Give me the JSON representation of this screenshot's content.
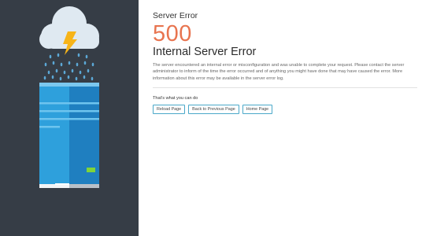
{
  "error": {
    "label": "Server Error",
    "code": "500",
    "title": "Internal Server Error",
    "description": "The server encountered an internal error or misconfiguration and was unable to complete your request. Please contact the server administrator to inform of the time the error occurred and of anything you might have done that may have caused the error. More information about this error may be available in the server error log."
  },
  "actions": {
    "heading": "That's what you can do",
    "buttons": [
      {
        "label": "Reload Page"
      },
      {
        "label": "Back to Previous Page"
      },
      {
        "label": "Home Page"
      }
    ]
  },
  "illustration": {
    "icons": [
      "cloud-icon",
      "lightning-icon",
      "rain-icon",
      "server-icon",
      "status-led-icon"
    ],
    "colors": {
      "background": "#363d46",
      "cloud": "#dfe9f1",
      "lightning": "#f7b418",
      "rain": "#5ca8d6",
      "server_front": "#2ea0dc",
      "server_side": "#1f7fc0",
      "led": "#7fd43a"
    }
  },
  "colors": {
    "accent": "#e8744f",
    "button_border": "#4aa8c9"
  }
}
